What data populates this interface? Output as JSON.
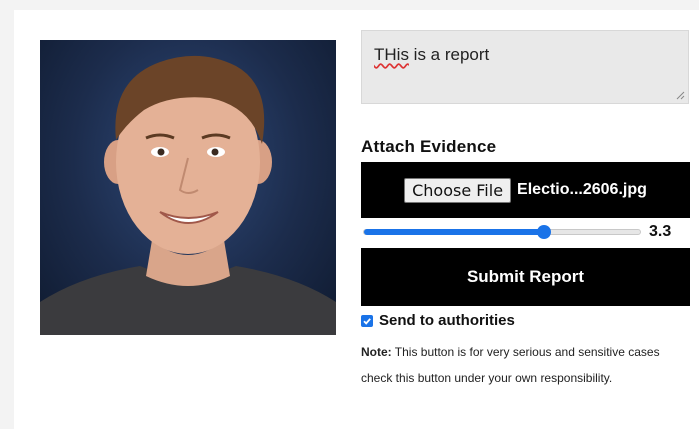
{
  "report": {
    "text_misspelled": "THis",
    "text_rest": " is a report"
  },
  "evidence": {
    "heading": "Attach Evidence",
    "choose_file_label": "Choose File",
    "file_name": "Electio...2606.jpg"
  },
  "slider": {
    "value": 3.3,
    "value_label": "3.3",
    "fraction": 0.65
  },
  "submit_label": "Submit Report",
  "authorities": {
    "checked": true,
    "label": "Send to authorities"
  },
  "note": {
    "prefix": "Note:",
    "text": " This button is for very serious and sensitive cases check this button under your own responsibility."
  },
  "colors": {
    "accent": "#1a73e8",
    "button_bg": "#000000"
  }
}
